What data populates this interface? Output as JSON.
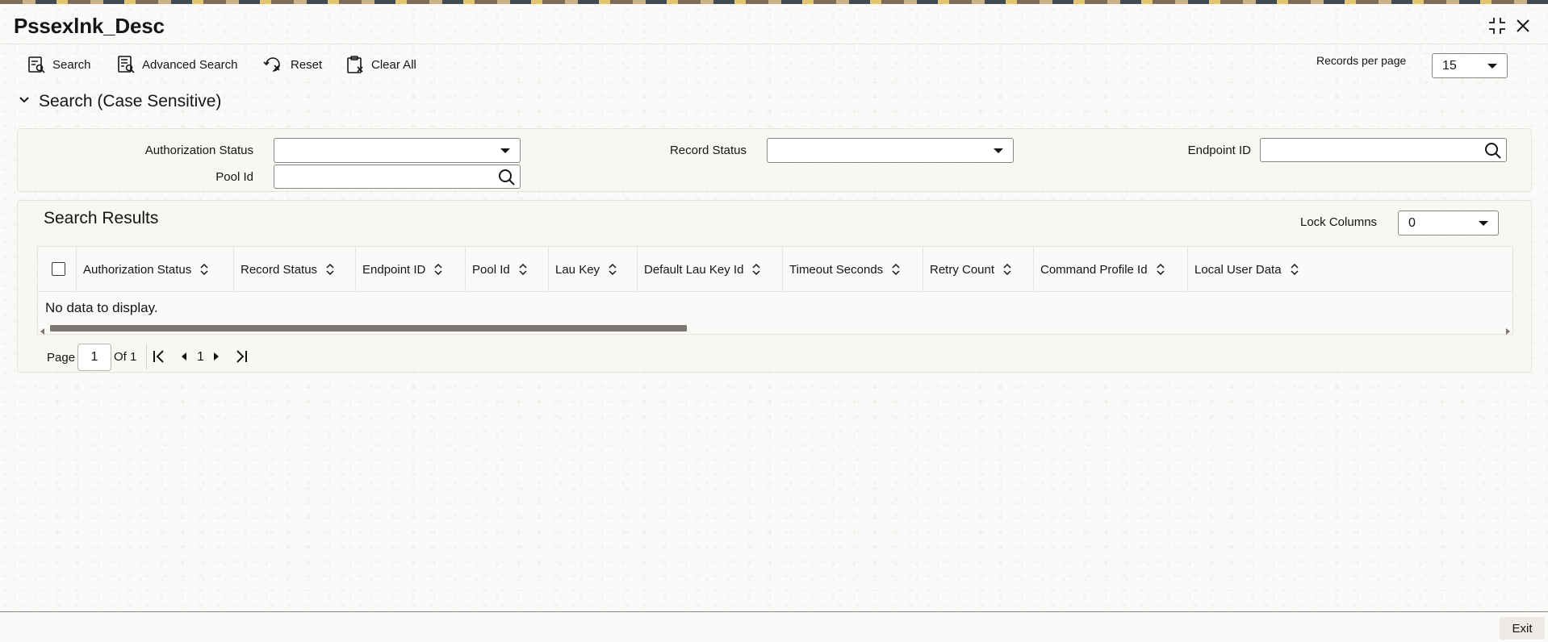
{
  "window": {
    "title": "Pssexlnk_Desc"
  },
  "toolbar": {
    "search_label": "Search",
    "advanced_search_label": "Advanced Search",
    "reset_label": "Reset",
    "clear_all_label": "Clear All",
    "records_per_page_label": "Records per page",
    "records_per_page_value": "15"
  },
  "search_section": {
    "title": "Search (Case Sensitive)",
    "fields": {
      "authorization_status_label": "Authorization Status",
      "authorization_status_value": "",
      "record_status_label": "Record Status",
      "record_status_value": "",
      "endpoint_id_label": "Endpoint ID",
      "endpoint_id_value": "",
      "pool_id_label": "Pool Id",
      "pool_id_value": ""
    }
  },
  "results": {
    "title": "Search Results",
    "lock_columns_label": "Lock Columns",
    "lock_columns_value": "0",
    "columns": [
      "Authorization Status",
      "Record Status",
      "Endpoint ID",
      "Pool Id",
      "Lau Key",
      "Default Lau Key Id",
      "Timeout Seconds",
      "Retry Count",
      "Command Profile Id",
      "Local User Data"
    ],
    "empty_message": "No data to display."
  },
  "pagination": {
    "page_label": "Page",
    "current_page": "1",
    "of_label": "Of 1",
    "page_number": "1"
  },
  "footer": {
    "exit_label": "Exit"
  },
  "icons": {
    "maximize": "maximize-icon",
    "close": "close-icon",
    "search": "search-icon",
    "advanced_search": "advanced-search-icon",
    "reset": "reset-icon",
    "clear_all": "clear-all-icon",
    "chevron": "chevron-down-icon",
    "sort": "sort-icon",
    "first": "first-page-icon",
    "prev": "previous-page-icon",
    "next": "next-page-icon",
    "last": "last-page-icon"
  }
}
